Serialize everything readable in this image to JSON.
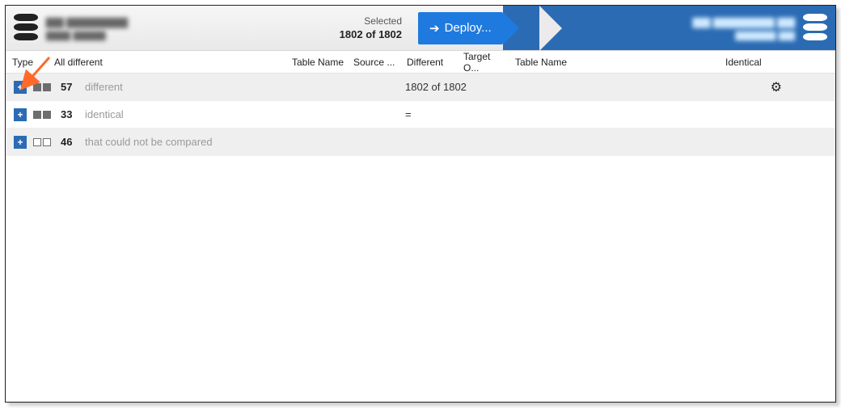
{
  "header": {
    "selected_label": "Selected",
    "selected_count": "1802 of 1802",
    "deploy_label": "Deploy..."
  },
  "columns": {
    "type": "Type",
    "all_different": "All different",
    "table_name_1": "Table Name",
    "source": "Source ...",
    "different": "Different",
    "target": "Target O...",
    "table_name_2": "Table Name",
    "identical": "Identical"
  },
  "groups": [
    {
      "count": "57",
      "label": "different",
      "center": "1802 of 1802",
      "filled": true,
      "has_gear": true,
      "alt": true
    },
    {
      "count": "33",
      "label": "identical",
      "center": "=",
      "filled": true,
      "has_gear": false,
      "alt": false
    },
    {
      "count": "46",
      "label": "that could not be compared",
      "center": "",
      "filled": false,
      "has_gear": false,
      "alt": true
    }
  ]
}
